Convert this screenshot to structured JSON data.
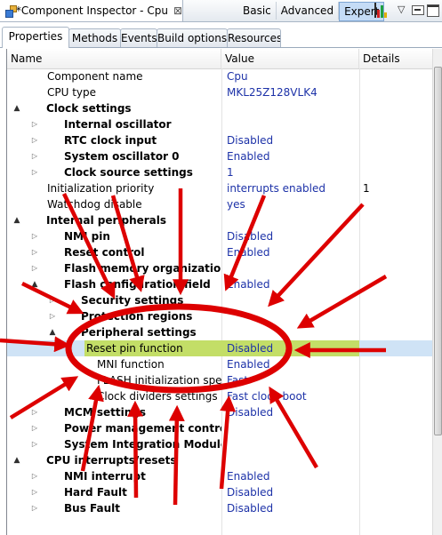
{
  "view": {
    "title": "*Component Inspector - Cpu",
    "close_glyph": "⊠",
    "mode_tabs": [
      {
        "label": "Basic",
        "active": false
      },
      {
        "label": "Advanced",
        "active": false
      },
      {
        "label": "Expert",
        "active": true
      }
    ],
    "icons": [
      "component-inspector-icon",
      "close-icon",
      "chart-icon",
      "view-menu-icon",
      "minimize-icon",
      "maximize-icon"
    ],
    "view_menu_glyph": "▽"
  },
  "page_tabs": [
    "Properties",
    "Methods",
    "Events",
    "Build options",
    "Resources"
  ],
  "active_page_tab": "Properties",
  "columns": {
    "name": "Name",
    "value": "Value",
    "details": "Details"
  },
  "rows": [
    {
      "name": "Component name",
      "value": "Cpu",
      "details": "",
      "bold": false,
      "toggle": ""
    },
    {
      "name": "CPU type",
      "value": "MKL25Z128VLK4",
      "details": "",
      "bold": false,
      "toggle": ""
    },
    {
      "name": "Clock settings",
      "value": "",
      "details": "",
      "bold": true,
      "toggle": "▲"
    },
    {
      "name": "Internal oscillator",
      "value": "",
      "details": "",
      "bold": true,
      "toggle": "▷"
    },
    {
      "name": "RTC clock input",
      "value": "Disabled",
      "details": "",
      "bold": true,
      "toggle": "▷"
    },
    {
      "name": "System oscillator 0",
      "value": "Enabled",
      "details": "",
      "bold": true,
      "toggle": "▷"
    },
    {
      "name": "Clock source settings",
      "value": "1",
      "details": "",
      "bold": true,
      "toggle": "▷"
    },
    {
      "name": "Initialization priority",
      "value": "interrupts enabled",
      "details": "1",
      "bold": false,
      "toggle": ""
    },
    {
      "name": "Watchdog disable",
      "value": "yes",
      "details": "",
      "bold": false,
      "toggle": ""
    },
    {
      "name": "Internal peripherals",
      "value": "",
      "details": "",
      "bold": true,
      "toggle": "▲"
    },
    {
      "name": "NMI pin",
      "value": "Disabled",
      "details": "",
      "bold": true,
      "toggle": "▷"
    },
    {
      "name": "Reset control",
      "value": "Enabled",
      "details": "",
      "bold": true,
      "toggle": "▷"
    },
    {
      "name": "Flash memory organization",
      "value": "",
      "details": "",
      "bold": true,
      "toggle": "▷"
    },
    {
      "name": "Flash configuration field",
      "value": "Enabled",
      "details": "",
      "bold": true,
      "toggle": "▲"
    },
    {
      "name": "Security settings",
      "value": "",
      "details": "",
      "bold": true,
      "toggle": "▷"
    },
    {
      "name": "Protection regions",
      "value": "",
      "details": "",
      "bold": true,
      "toggle": "▷"
    },
    {
      "name": "Peripheral settings",
      "value": "",
      "details": "",
      "bold": true,
      "toggle": "▲"
    },
    {
      "name": "Reset pin function",
      "value": "Disabled",
      "details": "",
      "bold": false,
      "toggle": "",
      "selected": true
    },
    {
      "name": "MNI function",
      "value": "Enabled",
      "details": "",
      "bold": false,
      "toggle": ""
    },
    {
      "name": "FLASH initialization speed",
      "value": "Fast",
      "details": "",
      "bold": false,
      "toggle": ""
    },
    {
      "name": "Clock dividers settings",
      "value": "Fast clock boot",
      "details": "",
      "bold": false,
      "toggle": ""
    },
    {
      "name": "MCM settings",
      "value": "Disabled",
      "details": "",
      "bold": true,
      "toggle": "▷"
    },
    {
      "name": "Power management controller",
      "value": "",
      "details": "",
      "bold": true,
      "toggle": "▷"
    },
    {
      "name": "System Integration Module",
      "value": "",
      "details": "",
      "bold": true,
      "toggle": "▷"
    },
    {
      "name": "CPU interrupts/resets",
      "value": "",
      "details": "",
      "bold": true,
      "toggle": "▲"
    },
    {
      "name": "NMI interrupt",
      "value": "Enabled",
      "details": "",
      "bold": true,
      "toggle": "▷"
    },
    {
      "name": "Hard Fault",
      "value": "Disabled",
      "details": "",
      "bold": true,
      "toggle": "▷"
    },
    {
      "name": "Bus Fault",
      "value": "Disabled",
      "details": "",
      "bold": true,
      "toggle": "▷"
    }
  ],
  "colors": {
    "value_text": "#1d32a8",
    "selected_row": "#cfe3f6",
    "selected_highlight": "#c3de67",
    "annotation_red": "#dd0000",
    "active_mode_tab": "#c5dcf6"
  }
}
